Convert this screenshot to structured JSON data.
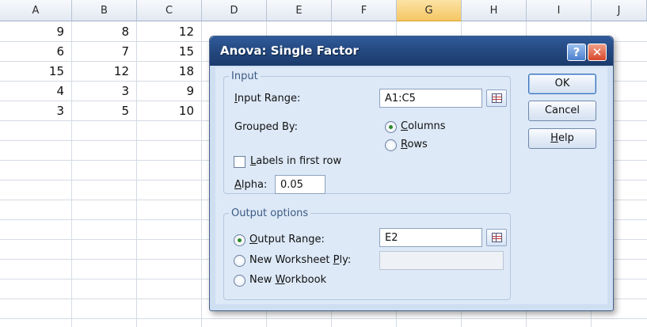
{
  "sheet": {
    "columns": [
      "A",
      "B",
      "C",
      "D",
      "E",
      "F",
      "G",
      "H",
      "I",
      "J"
    ],
    "selected_column": "G",
    "rows": [
      [
        "9",
        "8",
        "12"
      ],
      [
        "6",
        "7",
        "15"
      ],
      [
        "15",
        "12",
        "18"
      ],
      [
        "4",
        "3",
        "9"
      ],
      [
        "3",
        "5",
        "10"
      ]
    ]
  },
  "dialog": {
    "title": "Anova: Single Factor",
    "title_help_glyph": "?",
    "title_close_glyph": "✕",
    "input_group": {
      "legend": "Input",
      "range_label_first": "I",
      "range_label_rest": "nput Range:",
      "range_value": "A1:C5",
      "grouped_by_label": "Grouped By:",
      "columns_first": "C",
      "columns_rest": "olumns",
      "rows_first": "R",
      "rows_rest": "ows",
      "labels_first": "L",
      "labels_rest": "abels in first row",
      "alpha_first": "A",
      "alpha_rest": "lpha:",
      "alpha_value": "0.05",
      "grouped_by": "columns",
      "labels_checked": false
    },
    "output_group": {
      "legend": "Output options",
      "output_range_first": "O",
      "output_range_rest": "utput Range:",
      "output_range_value": "E2",
      "new_ply_pre": "New Worksheet ",
      "new_ply_ul": "P",
      "new_ply_post": "ly:",
      "new_ply_value": "",
      "new_wb_pre": "New ",
      "new_wb_ul": "W",
      "new_wb_post": "orkbook",
      "selected": "output_range"
    },
    "buttons": {
      "ok": "OK",
      "cancel": "Cancel",
      "help_first": "H",
      "help_rest": "elp"
    }
  }
}
